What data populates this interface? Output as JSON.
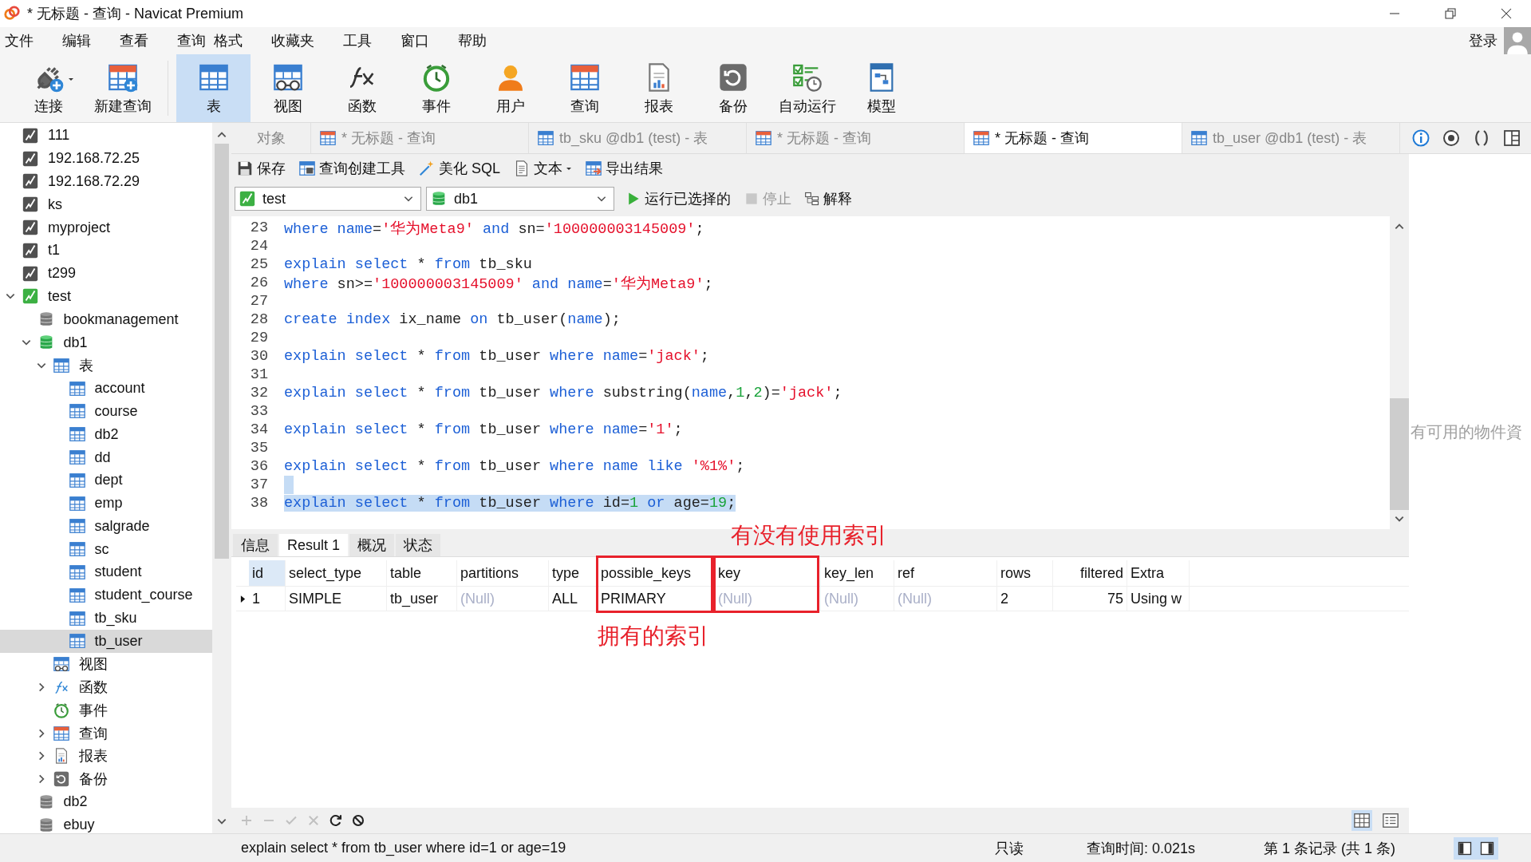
{
  "window": {
    "title": "* 无标题 - 查询 - Navicat Premium"
  },
  "menu": [
    "文件",
    "编辑",
    "查看",
    "查询",
    "格式",
    "收藏夹",
    "工具",
    "窗口",
    "帮助"
  ],
  "account": {
    "label": "登录"
  },
  "toolbar": [
    {
      "label": "连接",
      "kind": "connect",
      "dropdown": true,
      "selected": false
    },
    {
      "label": "新建查询",
      "kind": "new-query",
      "dropdown": false,
      "selected": false
    },
    {
      "label": "表",
      "kind": "table",
      "dropdown": false,
      "selected": true
    },
    {
      "label": "视图",
      "kind": "view",
      "dropdown": false,
      "selected": false
    },
    {
      "label": "函数",
      "kind": "function",
      "dropdown": false,
      "selected": false
    },
    {
      "label": "事件",
      "kind": "event",
      "dropdown": false,
      "selected": false
    },
    {
      "label": "用户",
      "kind": "user",
      "dropdown": false,
      "selected": false
    },
    {
      "label": "查询",
      "kind": "query",
      "dropdown": false,
      "selected": false
    },
    {
      "label": "报表",
      "kind": "report",
      "dropdown": false,
      "selected": false
    },
    {
      "label": "备份",
      "kind": "backup",
      "dropdown": false,
      "selected": false
    },
    {
      "label": "自动运行",
      "kind": "automation",
      "dropdown": false,
      "selected": false
    },
    {
      "label": "模型",
      "kind": "model",
      "dropdown": false,
      "selected": false
    }
  ],
  "tree": [
    {
      "label": "111",
      "kind": "connection",
      "connected": false,
      "selected": false
    },
    {
      "label": "192.168.72.25",
      "kind": "connection",
      "connected": false,
      "selected": false
    },
    {
      "label": "192.168.72.29",
      "kind": "connection",
      "connected": false,
      "selected": false
    },
    {
      "label": "ks",
      "kind": "connection",
      "connected": false,
      "selected": false
    },
    {
      "label": "myproject",
      "kind": "connection",
      "connected": false,
      "selected": false
    },
    {
      "label": "t1",
      "kind": "connection",
      "connected": false,
      "selected": false
    },
    {
      "label": "t299",
      "kind": "connection",
      "connected": false,
      "selected": false
    },
    {
      "label": "test",
      "kind": "connection",
      "connected": true,
      "expanded": true,
      "selected": false,
      "children": [
        {
          "label": "bookmanagement",
          "kind": "database",
          "connected": false,
          "selected": false
        },
        {
          "label": "db1",
          "kind": "database",
          "connected": true,
          "expanded": true,
          "selected": false,
          "children": [
            {
              "label": "表",
              "kind": "tables",
              "expanded": true,
              "selected": false,
              "children": [
                {
                  "label": "account",
                  "kind": "table",
                  "selected": false
                },
                {
                  "label": "course",
                  "kind": "table",
                  "selected": false
                },
                {
                  "label": "db2",
                  "kind": "table",
                  "selected": false
                },
                {
                  "label": "dd",
                  "kind": "table",
                  "selected": false
                },
                {
                  "label": "dept",
                  "kind": "table",
                  "selected": false
                },
                {
                  "label": "emp",
                  "kind": "table",
                  "selected": false
                },
                {
                  "label": "salgrade",
                  "kind": "table",
                  "selected": false
                },
                {
                  "label": "sc",
                  "kind": "table",
                  "selected": false
                },
                {
                  "label": "student",
                  "kind": "table",
                  "selected": false
                },
                {
                  "label": "student_course",
                  "kind": "table",
                  "selected": false
                },
                {
                  "label": "tb_sku",
                  "kind": "table",
                  "selected": false
                },
                {
                  "label": "tb_user",
                  "kind": "table",
                  "selected": true
                }
              ]
            },
            {
              "label": "视图",
              "kind": "views",
              "selected": false
            },
            {
              "label": "函数",
              "kind": "functions",
              "expanded": false,
              "selected": false
            },
            {
              "label": "事件",
              "kind": "events",
              "selected": false
            },
            {
              "label": "查询",
              "kind": "queries",
              "expanded": false,
              "selected": false
            },
            {
              "label": "报表",
              "kind": "reports",
              "expanded": false,
              "selected": false
            },
            {
              "label": "备份",
              "kind": "backups",
              "expanded": false,
              "selected": false
            }
          ]
        },
        {
          "label": "db2",
          "kind": "database",
          "connected": false,
          "selected": false
        },
        {
          "label": "ebuy",
          "kind": "database",
          "connected": false,
          "selected": false
        }
      ]
    }
  ],
  "tabs": [
    {
      "label": "对象",
      "kind": "objects",
      "selected": false
    },
    {
      "label": "* 无标题 - 查询",
      "kind": "query",
      "selected": false
    },
    {
      "label": "tb_sku @db1 (test) - 表",
      "kind": "table",
      "selected": false
    },
    {
      "label": "* 无标题 - 查询",
      "kind": "query",
      "selected": false
    },
    {
      "label": "* 无标题 - 查询",
      "kind": "query",
      "selected": true
    },
    {
      "label": "tb_user @db1 (test) - 表",
      "kind": "table",
      "selected": false
    }
  ],
  "side_tools": [
    {
      "kind": "info"
    },
    {
      "kind": "preview"
    },
    {
      "kind": "braces"
    },
    {
      "kind": "panel"
    }
  ],
  "editor_toolbar": [
    {
      "label": "保存",
      "kind": "save",
      "dropdown": false
    },
    {
      "label": "查询创建工具",
      "kind": "builder",
      "dropdown": false
    },
    {
      "label": "美化 SQL",
      "kind": "beautify",
      "dropdown": false
    },
    {
      "label": "文本",
      "kind": "text",
      "dropdown": true
    },
    {
      "label": "导出结果",
      "kind": "export",
      "dropdown": false
    }
  ],
  "connection_select": {
    "value": "test"
  },
  "database_select": {
    "value": "db1"
  },
  "run_buttons": [
    {
      "label": "运行已选择的",
      "kind": "run",
      "disabled": false
    },
    {
      "label": "停止",
      "kind": "stop",
      "disabled": true
    },
    {
      "label": "解释",
      "kind": "explain",
      "disabled": false
    }
  ],
  "editor": {
    "lines": [
      {
        "number": "23",
        "selected": false,
        "tokens": [
          {
            "kind": "keyword",
            "text": "where"
          },
          {
            "kind": "keyword",
            "text": " name"
          },
          {
            "kind": "plain",
            "text": "="
          },
          {
            "kind": "string",
            "text": "'华为Meta9'"
          },
          {
            "kind": "keyword",
            "text": " and"
          },
          {
            "kind": "plain",
            "text": " sn="
          },
          {
            "kind": "string",
            "text": "'100000003145009'"
          },
          {
            "kind": "plain",
            "text": ";"
          }
        ]
      },
      {
        "number": "24",
        "selected": false
      },
      {
        "number": "25",
        "selected": false,
        "tokens": [
          {
            "kind": "keyword",
            "text": "explain"
          },
          {
            "kind": "keyword",
            "text": " select"
          },
          {
            "kind": "plain",
            "text": " * "
          },
          {
            "kind": "keyword",
            "text": "from"
          },
          {
            "kind": "plain",
            "text": " tb_sku"
          }
        ]
      },
      {
        "number": "26",
        "selected": false,
        "tokens": [
          {
            "kind": "keyword",
            "text": "where"
          },
          {
            "kind": "plain",
            "text": " sn>="
          },
          {
            "kind": "string",
            "text": "'100000003145009'"
          },
          {
            "kind": "keyword",
            "text": " and"
          },
          {
            "kind": "keyword",
            "text": " name"
          },
          {
            "kind": "plain",
            "text": "="
          },
          {
            "kind": "string",
            "text": "'华为Meta9'"
          },
          {
            "kind": "plain",
            "text": ";"
          }
        ]
      },
      {
        "number": "27",
        "selected": false
      },
      {
        "number": "28",
        "selected": false,
        "tokens": [
          {
            "kind": "keyword",
            "text": "create"
          },
          {
            "kind": "keyword",
            "text": " index"
          },
          {
            "kind": "plain",
            "text": " ix_name "
          },
          {
            "kind": "keyword",
            "text": "on"
          },
          {
            "kind": "plain",
            "text": " tb_user("
          },
          {
            "kind": "keyword",
            "text": "name"
          },
          {
            "kind": "plain",
            "text": ");"
          }
        ]
      },
      {
        "number": "29",
        "selected": false
      },
      {
        "number": "30",
        "selected": false,
        "tokens": [
          {
            "kind": "keyword",
            "text": "explain"
          },
          {
            "kind": "keyword",
            "text": " select"
          },
          {
            "kind": "plain",
            "text": " * "
          },
          {
            "kind": "keyword",
            "text": "from"
          },
          {
            "kind": "plain",
            "text": " tb_user "
          },
          {
            "kind": "keyword",
            "text": "where"
          },
          {
            "kind": "keyword",
            "text": " name"
          },
          {
            "kind": "plain",
            "text": "="
          },
          {
            "kind": "string",
            "text": "'jack'"
          },
          {
            "kind": "plain",
            "text": ";"
          }
        ]
      },
      {
        "number": "31",
        "selected": false
      },
      {
        "number": "32",
        "selected": false,
        "tokens": [
          {
            "kind": "keyword",
            "text": "explain"
          },
          {
            "kind": "keyword",
            "text": " select"
          },
          {
            "kind": "plain",
            "text": " * "
          },
          {
            "kind": "keyword",
            "text": "from"
          },
          {
            "kind": "plain",
            "text": " tb_user "
          },
          {
            "kind": "keyword",
            "text": "where"
          },
          {
            "kind": "plain",
            "text": " substring("
          },
          {
            "kind": "keyword",
            "text": "name"
          },
          {
            "kind": "plain",
            "text": ","
          },
          {
            "kind": "number",
            "text": "1"
          },
          {
            "kind": "plain",
            "text": ","
          },
          {
            "kind": "number",
            "text": "2"
          },
          {
            "kind": "plain",
            "text": ")="
          },
          {
            "kind": "string",
            "text": "'jack'"
          },
          {
            "kind": "plain",
            "text": ";"
          }
        ]
      },
      {
        "number": "33",
        "selected": false
      },
      {
        "number": "34",
        "selected": false,
        "tokens": [
          {
            "kind": "keyword",
            "text": "explain"
          },
          {
            "kind": "keyword",
            "text": " select"
          },
          {
            "kind": "plain",
            "text": " * "
          },
          {
            "kind": "keyword",
            "text": "from"
          },
          {
            "kind": "plain",
            "text": " tb_user "
          },
          {
            "kind": "keyword",
            "text": "where"
          },
          {
            "kind": "keyword",
            "text": " name"
          },
          {
            "kind": "plain",
            "text": "="
          },
          {
            "kind": "string",
            "text": "'1'"
          },
          {
            "kind": "plain",
            "text": ";"
          }
        ]
      },
      {
        "number": "35",
        "selected": false
      },
      {
        "number": "36",
        "selected": false,
        "tokens": [
          {
            "kind": "keyword",
            "text": "explain"
          },
          {
            "kind": "keyword",
            "text": " select"
          },
          {
            "kind": "plain",
            "text": " * "
          },
          {
            "kind": "keyword",
            "text": "from"
          },
          {
            "kind": "plain",
            "text": " tb_user "
          },
          {
            "kind": "keyword",
            "text": "where"
          },
          {
            "kind": "keyword",
            "text": " name"
          },
          {
            "kind": "keyword",
            "text": " like"
          },
          {
            "kind": "string",
            "text": " '%1%'"
          },
          {
            "kind": "plain",
            "text": ";"
          }
        ]
      },
      {
        "number": "37",
        "selected": true
      },
      {
        "number": "38",
        "selected": true,
        "tokens": [
          {
            "kind": "keyword",
            "text": "explain"
          },
          {
            "kind": "keyword",
            "text": " select"
          },
          {
            "kind": "plain",
            "text": " * "
          },
          {
            "kind": "keyword",
            "text": "from"
          },
          {
            "kind": "plain",
            "text": " tb_user "
          },
          {
            "kind": "keyword",
            "text": "where"
          },
          {
            "kind": "plain",
            "text": " id="
          },
          {
            "kind": "number",
            "text": "1"
          },
          {
            "kind": "keyword",
            "text": " or"
          },
          {
            "kind": "plain",
            "text": " age="
          },
          {
            "kind": "number",
            "text": "19"
          },
          {
            "kind": "plain",
            "text": ";"
          }
        ]
      }
    ]
  },
  "result_tabs": [
    {
      "label": "信息",
      "selected": false
    },
    {
      "label": "Result 1",
      "selected": true
    },
    {
      "label": "概况",
      "selected": false
    },
    {
      "label": "状态",
      "selected": false
    }
  ],
  "grid": {
    "columns": [
      {
        "label": "id",
        "highlighted": true
      },
      {
        "label": "select_type",
        "highlighted": false
      },
      {
        "label": "table",
        "highlighted": false
      },
      {
        "label": "partitions",
        "highlighted": false
      },
      {
        "label": "type",
        "highlighted": false
      },
      {
        "label": "possible_keys",
        "highlighted": false,
        "note_below": "拥有的索引"
      },
      {
        "label": "key",
        "highlighted": false,
        "note_above": "有没有使用索引"
      },
      {
        "label": "key_len",
        "highlighted": false
      },
      {
        "label": "ref",
        "highlighted": false
      },
      {
        "label": "rows",
        "highlighted": false
      },
      {
        "label": "filtered",
        "highlighted": false
      },
      {
        "label": "Extra",
        "highlighted": false
      }
    ],
    "rows": [
      {
        "current": true,
        "cells": [
          {
            "text": "1",
            "null": false
          },
          {
            "text": "SIMPLE",
            "null": false
          },
          {
            "text": "tb_user",
            "null": false
          },
          {
            "text": "(Null)",
            "null": true
          },
          {
            "text": "ALL",
            "null": false
          },
          {
            "text": "PRIMARY",
            "null": false
          },
          {
            "text": "(Null)",
            "null": true
          },
          {
            "text": "(Null)",
            "null": true
          },
          {
            "text": "(Null)",
            "null": true
          },
          {
            "text": "2",
            "null": false
          },
          {
            "text": "75",
            "null": false
          },
          {
            "text": "Using w",
            "null": false
          }
        ]
      }
    ]
  },
  "grid_actions": [
    {
      "kind": "add",
      "disabled": true
    },
    {
      "kind": "remove",
      "disabled": true
    },
    {
      "kind": "apply",
      "disabled": true
    },
    {
      "kind": "discard",
      "disabled": true
    },
    {
      "kind": "refresh",
      "disabled": false
    },
    {
      "kind": "stop",
      "disabled": false
    }
  ],
  "view_toggle": [
    {
      "kind": "grid",
      "selected": true
    },
    {
      "kind": "form",
      "selected": false
    }
  ],
  "info_panel": {
    "message": "有可用的物件資"
  },
  "status_bar": {
    "sql": "explain select * from tb_user where id=1 or age=19",
    "mode": "只读",
    "query_time": "查询时间: 0.021s",
    "record": "第 1 条记录 (共 1 条)"
  },
  "layout_toggle": [
    {
      "kind": "left-panel",
      "selected": true
    },
    {
      "kind": "right-panel",
      "selected": true
    }
  ]
}
